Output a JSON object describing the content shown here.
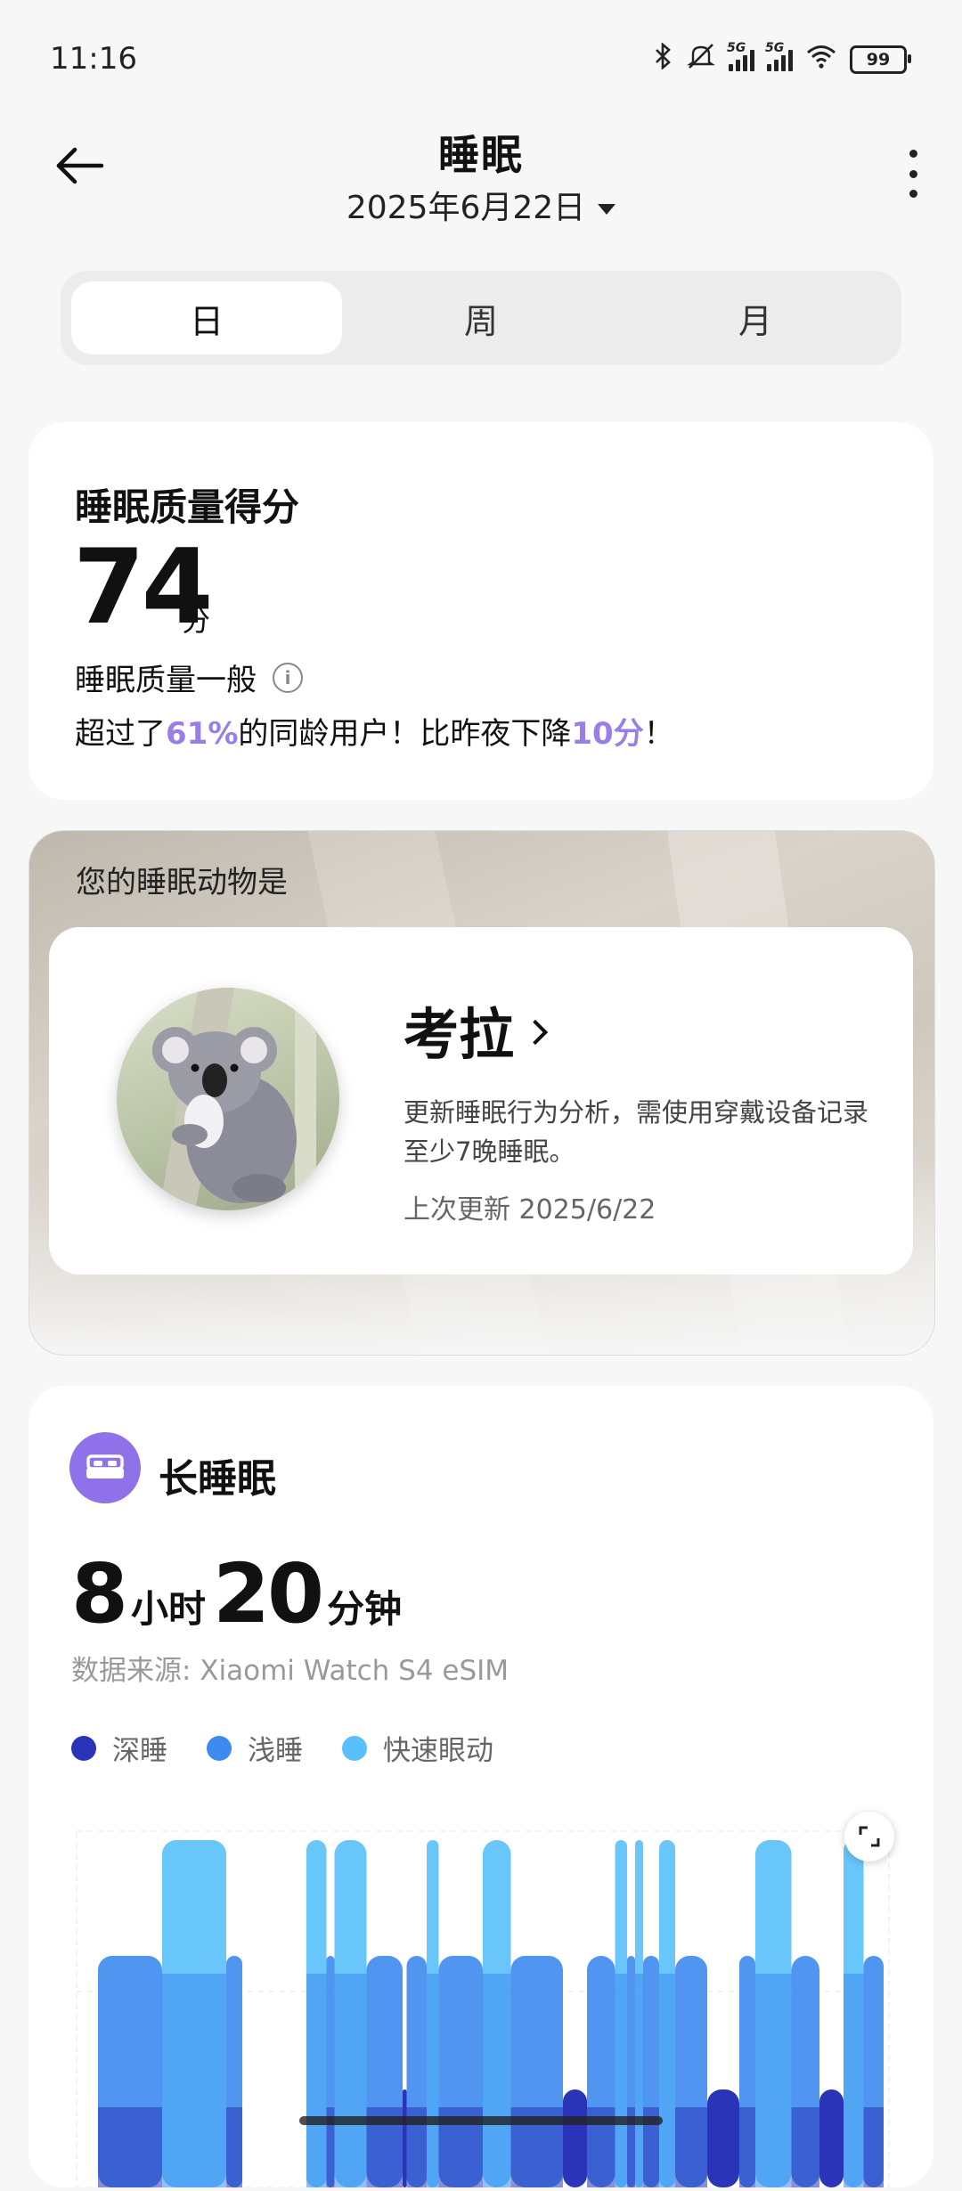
{
  "status_bar": {
    "time": "11:16",
    "network_1": "5G",
    "network_2": "5G",
    "battery": "99"
  },
  "header": {
    "title": "睡眠",
    "date": "2025年6月22日"
  },
  "tabs": [
    {
      "label": "日",
      "active": true
    },
    {
      "label": "周",
      "active": false
    },
    {
      "label": "月",
      "active": false
    }
  ],
  "score": {
    "title": "睡眠质量得分",
    "value": "74",
    "unit": "分",
    "quality_label": "睡眠质量一般",
    "compare_prefix": "超过了",
    "percentile": "61%",
    "compare_middle": "的同龄用户！比昨夜下降",
    "drop": "10分",
    "compare_suffix": "！"
  },
  "animal": {
    "heading": "您的睡眠动物是",
    "name": "考拉",
    "description": "更新睡眠行为分析，需使用穿戴设备记录至少7晚睡眠。",
    "last_update": "上次更新 2025/6/22"
  },
  "long_sleep": {
    "title": "长睡眠",
    "hours": "8",
    "hours_unit": "小时",
    "minutes": "20",
    "minutes_unit": "分钟",
    "source": "数据来源: Xiaomi Watch S4 eSIM",
    "legend": [
      {
        "label": "深睡",
        "color": "#2a34b8"
      },
      {
        "label": "浅睡",
        "color": "#3d8bf0"
      },
      {
        "label": "快速眼动",
        "color": "#58c0fa"
      }
    ]
  },
  "chart_data": {
    "type": "bar",
    "categories": [
      "深睡",
      "浅睡",
      "快速眼动"
    ],
    "series": [
      {
        "name": "深睡",
        "color": "#2a34b8"
      },
      {
        "name": "浅睡",
        "color": "#3d8bf0"
      },
      {
        "name": "快速眼动",
        "color": "#58c0fa"
      }
    ],
    "segments": [
      {
        "stage": 1,
        "start": 0.02,
        "end": 0.1
      },
      {
        "stage": 2,
        "start": 0.1,
        "end": 0.18
      },
      {
        "stage": 1,
        "start": 0.18,
        "end": 0.2
      },
      {
        "stage": 2,
        "start": 0.28,
        "end": 0.305
      },
      {
        "stage": 1,
        "start": 0.305,
        "end": 0.315
      },
      {
        "stage": 2,
        "start": 0.315,
        "end": 0.355
      },
      {
        "stage": 1,
        "start": 0.355,
        "end": 0.4
      },
      {
        "stage": 0,
        "start": 0.4,
        "end": 0.405
      },
      {
        "stage": 1,
        "start": 0.405,
        "end": 0.43
      },
      {
        "stage": 2,
        "start": 0.43,
        "end": 0.445
      },
      {
        "stage": 1,
        "start": 0.445,
        "end": 0.5
      },
      {
        "stage": 2,
        "start": 0.5,
        "end": 0.535
      },
      {
        "stage": 1,
        "start": 0.535,
        "end": 0.6
      },
      {
        "stage": 0,
        "start": 0.6,
        "end": 0.63
      },
      {
        "stage": 1,
        "start": 0.63,
        "end": 0.665
      },
      {
        "stage": 2,
        "start": 0.665,
        "end": 0.68
      },
      {
        "stage": 1,
        "start": 0.68,
        "end": 0.69
      },
      {
        "stage": 2,
        "start": 0.69,
        "end": 0.7
      },
      {
        "stage": 1,
        "start": 0.7,
        "end": 0.72
      },
      {
        "stage": 2,
        "start": 0.72,
        "end": 0.74
      },
      {
        "stage": 1,
        "start": 0.74,
        "end": 0.78
      },
      {
        "stage": 0,
        "start": 0.78,
        "end": 0.82
      },
      {
        "stage": 1,
        "start": 0.82,
        "end": 0.84
      },
      {
        "stage": 2,
        "start": 0.84,
        "end": 0.885
      },
      {
        "stage": 1,
        "start": 0.885,
        "end": 0.92
      },
      {
        "stage": 0,
        "start": 0.92,
        "end": 0.95
      },
      {
        "stage": 2,
        "start": 0.95,
        "end": 0.975
      },
      {
        "stage": 1,
        "start": 0.975,
        "end": 1.0
      }
    ]
  }
}
